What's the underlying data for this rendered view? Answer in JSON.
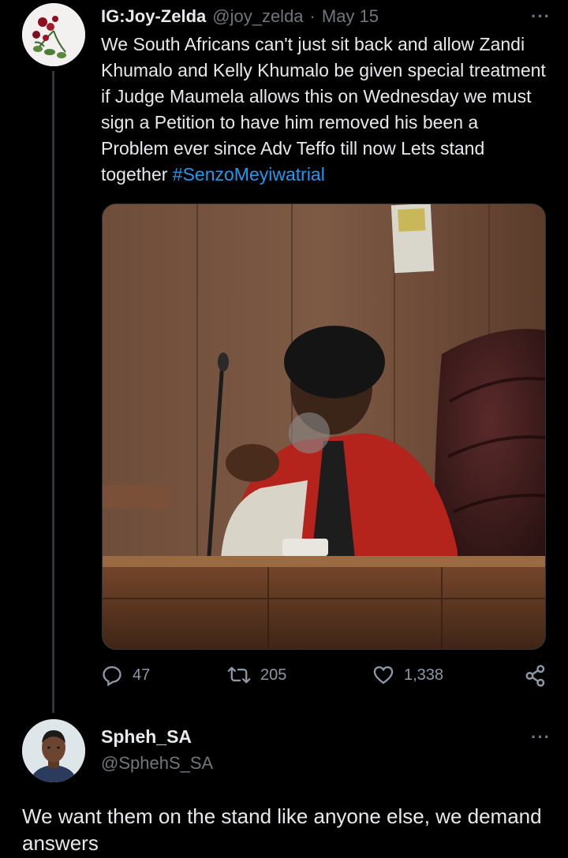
{
  "tweet": {
    "display_name": "IG:Joy-Zelda",
    "handle": "@joy_zelda",
    "separator": "·",
    "date": "May 15",
    "text": "We South Africans can't just sit back and allow Zandi Khumalo and Kelly Khumalo be given special treatment if Judge Maumela allows this on Wednesday we must sign a Petition to have him removed his been a Problem ever since Adv Teffo till now Lets stand together ",
    "hashtag": "#SenzoMeyiwatrial",
    "avatar_icon": "rose-flower-avatar",
    "more_icon": "more-dots-icon",
    "actions": {
      "replies": "47",
      "retweets": "205",
      "likes": "1,338"
    }
  },
  "reply": {
    "display_name": "Spheh_SA",
    "handle": "@SphehS_SA",
    "text": "We want them on the stand like anyone else, we demand answers",
    "avatar_icon": "person-avatar"
  },
  "colors": {
    "background": "#000000",
    "text": "#e7e9ea",
    "muted": "#71767b",
    "link": "#1d9bf0",
    "icon": "#8b98a5"
  }
}
